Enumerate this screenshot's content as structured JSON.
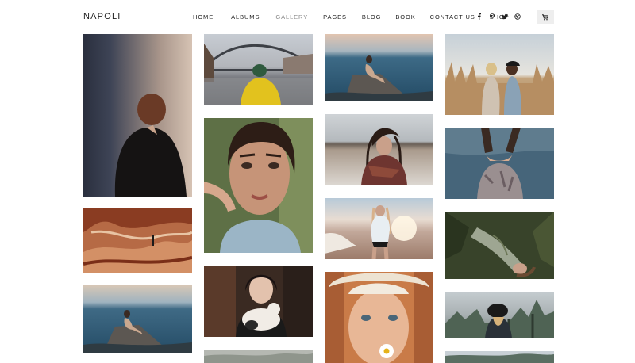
{
  "header": {
    "logo": "NAPOLI",
    "nav": [
      {
        "label": "HOME",
        "active": false
      },
      {
        "label": "ALBUMS",
        "active": false
      },
      {
        "label": "GALLERY",
        "active": true
      },
      {
        "label": "PAGES",
        "active": false
      },
      {
        "label": "BLOG",
        "active": false
      },
      {
        "label": "BOOK",
        "active": false
      },
      {
        "label": "CONTACT US",
        "active": false
      },
      {
        "label": "SHOP",
        "active": false
      }
    ],
    "social_icons": [
      "facebook-icon",
      "pinterest-icon",
      "twitter-icon",
      "dribbble-icon"
    ],
    "cart_icon": "cart-icon"
  },
  "gallery": {
    "photos": [
      {
        "name": "photo-woman-dark-back",
        "subject": "woman from behind in dark room"
      },
      {
        "name": "photo-red-rocks",
        "subject": "person on red rock formation"
      },
      {
        "name": "photo-woman-sitting-sea-1",
        "subject": "woman sitting on rock by sea"
      },
      {
        "name": "photo-bridge-yellow-jacket",
        "subject": "person in yellow jacket facing bridge"
      },
      {
        "name": "photo-portrait-hand",
        "subject": "close-up portrait of woman with hand"
      },
      {
        "name": "photo-woman-with-cat",
        "subject": "woman holding a cat"
      },
      {
        "name": "photo-partial-column2",
        "subject": "partially visible photo"
      },
      {
        "name": "photo-woman-sitting-sea-2",
        "subject": "woman sitting on rock by sea"
      },
      {
        "name": "photo-woman-scarf-wind",
        "subject": "woman with scarf in wind"
      },
      {
        "name": "photo-woman-beach-sunset",
        "subject": "woman on beach at sunset"
      },
      {
        "name": "photo-woman-hat-daisy",
        "subject": "woman in hat with daisy"
      },
      {
        "name": "photo-two-girls-field",
        "subject": "two girls in wheat field"
      },
      {
        "name": "photo-hands-water",
        "subject": "hands cupping water"
      },
      {
        "name": "photo-woman-lying-grass",
        "subject": "woman lying in grass"
      },
      {
        "name": "photo-woman-black-hat",
        "subject": "woman in black hat in nature"
      },
      {
        "name": "photo-partial-column4",
        "subject": "partially visible photo"
      }
    ]
  },
  "colors": {
    "nav_active": "#888888",
    "text": "#222222",
    "cart_bg": "#eeeeee"
  }
}
